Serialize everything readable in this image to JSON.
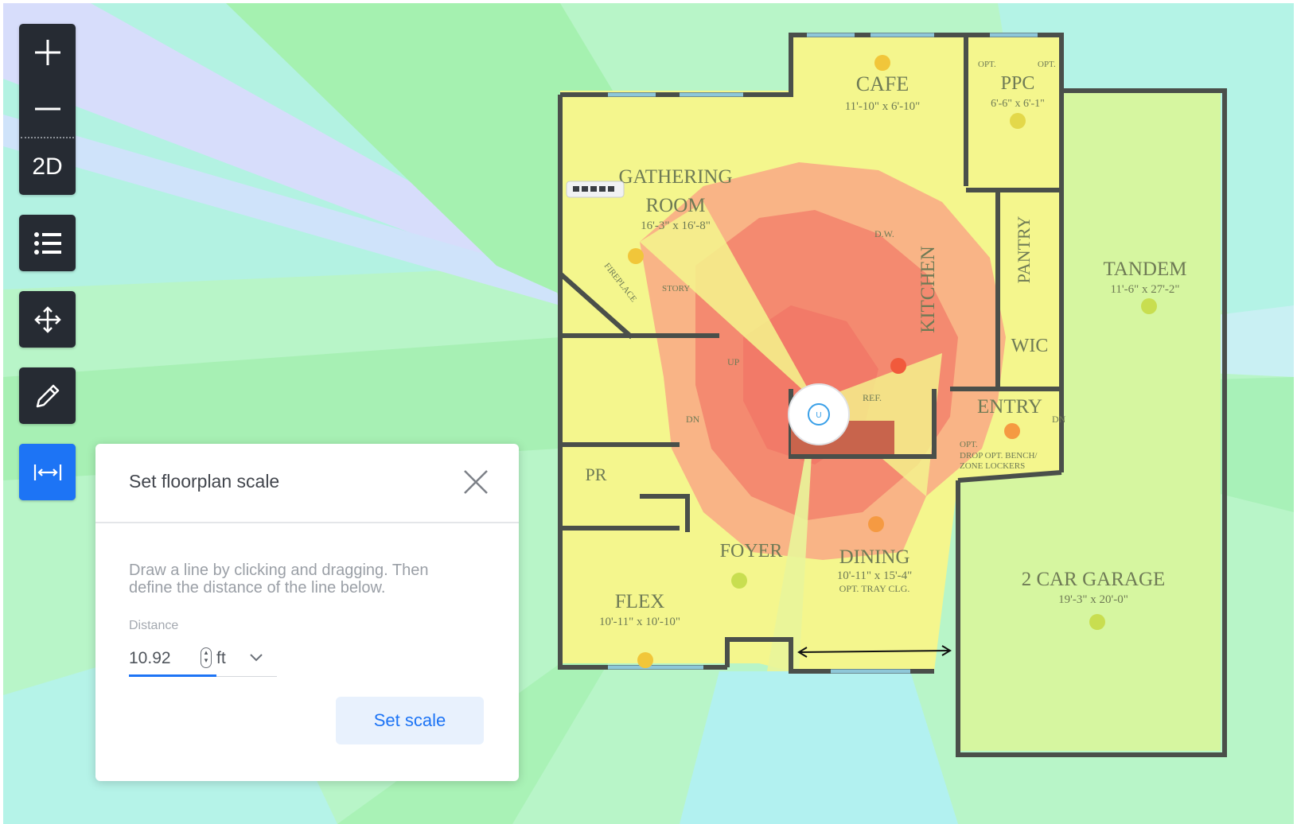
{
  "toolbar": {
    "zoom_in_icon": "plus-icon",
    "zoom_out_icon": "minus-icon",
    "view_mode_label": "2D",
    "list_icon": "list-icon",
    "move_icon": "move-arrows-icon",
    "draw_icon": "pencil-icon",
    "scale_icon": "measure-width-icon",
    "active_color": "#1d74f5",
    "bg_color": "#262b33"
  },
  "floorplan": {
    "rooms": [
      {
        "name": "CAFE",
        "dims": "11'-10\" x 6'-10\""
      },
      {
        "name": "PPC",
        "dims": "6'-6\" x 6'-1\""
      },
      {
        "name": "GATHERING",
        "name2": "ROOM",
        "dims": "16'-3\" x 16'-8\""
      },
      {
        "name": "KITCHEN"
      },
      {
        "name": "PANTRY"
      },
      {
        "name": "TANDEM",
        "dims": "11'-6\" x 27'-2\""
      },
      {
        "name": "WIC"
      },
      {
        "name": "ENTRY"
      },
      {
        "name": "PR"
      },
      {
        "name": "FOYER"
      },
      {
        "name": "DINING",
        "dims": "10'-11\" x 15'-4\"",
        "note": "OPT. TRAY CLG."
      },
      {
        "name": "FLEX",
        "dims": "10'-11\" x 10'-10\""
      },
      {
        "name": "2 CAR GARAGE",
        "dims": "19'-3\" x 20'-0\""
      }
    ],
    "small_labels": {
      "opt1": "OPT.",
      "opt2": "OPT.",
      "up": "UP",
      "dn1": "DN",
      "dn2": "DN",
      "ref": "REF.",
      "dw": "D.W.",
      "fireplace": "FIREPLACE",
      "story": "STORY",
      "entry_opt": "OPT.",
      "drop_zone": "DROP OPT. BENCH/",
      "zone_lockers": "ZONE    LOCKERS"
    },
    "access_point_icon": "access-point-icon",
    "switch_icon": "network-switch-icon",
    "warning_icon": "warning-dot-icon",
    "heat_colors": {
      "strong": "#f47a6a",
      "good": "#f9ad7f",
      "fair": "#f3f389",
      "weak": "#a8f5a6",
      "poor": "#b6f7f0",
      "none": "#d7ddfb"
    }
  },
  "dialog": {
    "title": "Set floorplan scale",
    "close_icon": "close-icon",
    "description": "Draw a line by clicking and dragging. Then define the distance of the line below.",
    "distance_label": "Distance",
    "distance_value": "10.92",
    "unit": "ft",
    "set_scale_label": "Set scale"
  }
}
